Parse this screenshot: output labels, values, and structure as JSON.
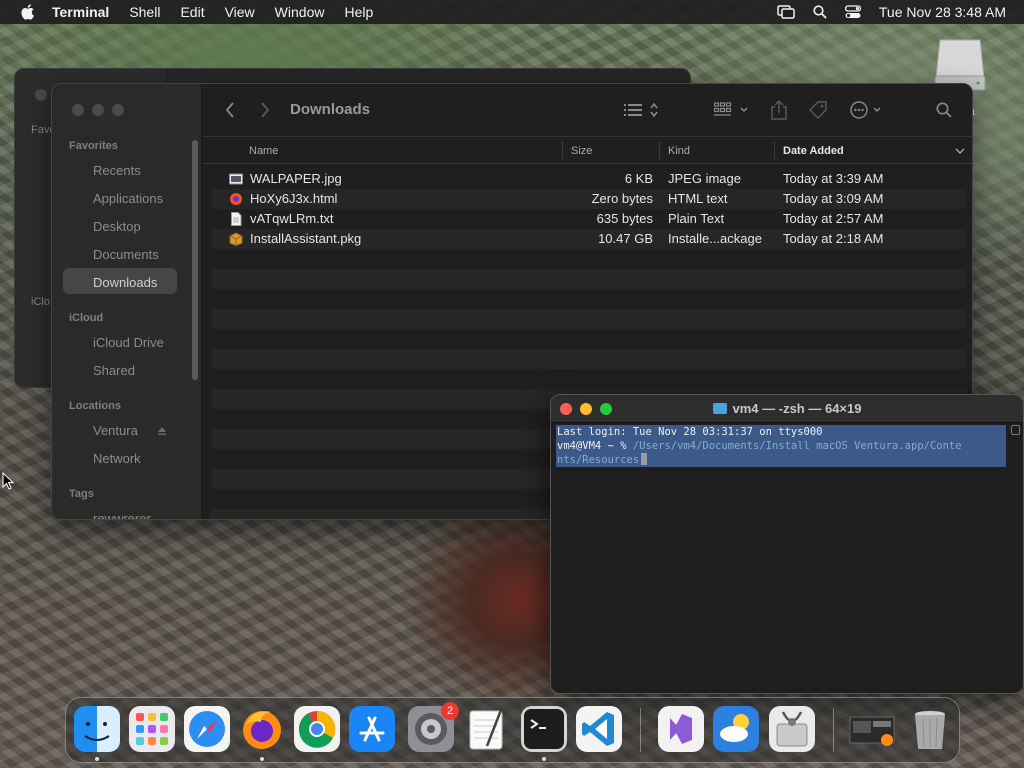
{
  "menubar": {
    "app_name": "Terminal",
    "menus": [
      "Shell",
      "Edit",
      "View",
      "Window",
      "Help"
    ],
    "clock": "Tue Nov 28  3:48 AM"
  },
  "desktop": {
    "drive_label": "a"
  },
  "ghost_window": {
    "favorites_label": "Favori",
    "icloud_label": "iClo"
  },
  "finder": {
    "title": "Downloads",
    "sidebar": {
      "favorites_header": "Favorites",
      "favorites": [
        "Recents",
        "Applications",
        "Desktop",
        "Documents",
        "Downloads"
      ],
      "selected": "Downloads",
      "icloud_header": "iCloud",
      "icloud": [
        "iCloud Drive",
        "Shared"
      ],
      "locations_header": "Locations",
      "locations": [
        "Ventura",
        "Network"
      ],
      "tags_header": "Tags",
      "tags": [
        "rewwrerer"
      ]
    },
    "columns": {
      "name": "Name",
      "size": "Size",
      "kind": "Kind",
      "date_added": "Date Added"
    },
    "files": [
      {
        "name": "WALPAPER.jpg",
        "size": "6 KB",
        "kind": "JPEG image",
        "date": "Today at 3:39 AM",
        "icon": "image-file-icon"
      },
      {
        "name": "HoXy6J3x.html",
        "size": "Zero bytes",
        "kind": "HTML text",
        "date": "Today at 3:09 AM",
        "icon": "html-file-icon"
      },
      {
        "name": "vATqwLRm.txt",
        "size": "635 bytes",
        "kind": "Plain Text",
        "date": "Today at 2:57 AM",
        "icon": "text-file-icon"
      },
      {
        "name": "InstallAssistant.pkg",
        "size": "10.47 GB",
        "kind": "Installe...ackage",
        "date": "Today at 2:18 AM",
        "icon": "package-icon"
      }
    ]
  },
  "terminal": {
    "title": "vm4 — -zsh — 64×19",
    "line1": "Last login: Tue Nov 28 03:31:37 on ttys000",
    "prompt": "vm4@VM4 ~ % ",
    "command": "/Users/vm4/Documents/Install macOS Ventura.app/Conte",
    "command_cont": "nts/Resources"
  },
  "dock": {
    "settings_badge": "2",
    "apps": [
      "Finder",
      "Launchpad",
      "Safari",
      "Firefox",
      "Chrome",
      "App Store",
      "System Settings",
      "TextEdit",
      "Terminal",
      "Visual Studio Code",
      "Visual Studio",
      "Weather",
      "Disk Utility",
      "Window Preview",
      "Trash"
    ]
  },
  "colors": {
    "selection": "#3b5a8a",
    "close": "#ff5f57",
    "minimize": "#febc2e",
    "zoom": "#28c840"
  }
}
